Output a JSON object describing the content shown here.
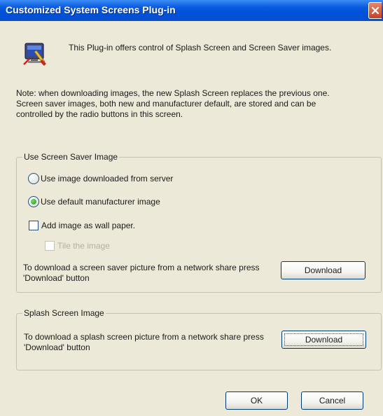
{
  "window": {
    "title": "Customized System Screens Plug-in"
  },
  "intro": "This Plug-in offers control of Splash Screen and Screen Saver images.",
  "note": {
    "line1": "Note: when downloading images, the new Splash Screen replaces the previous one.",
    "line2": "Screen saver images, both new and manufacturer default, are stored and can be controlled by the radio buttons in this screen."
  },
  "screen_saver": {
    "legend": "Use Screen Saver Image",
    "option_server": "Use image downloaded from server",
    "option_default": "Use default manufacturer image",
    "selected": "default",
    "wallpaper_label": "Add image as wall paper.",
    "tile_label": "Tile the image",
    "download_text": "To download a screen saver picture from a network share press 'Download' button",
    "download_button": "Download"
  },
  "splash": {
    "legend": "Splash Screen Image",
    "download_text": "To download a splash screen picture from a network share press 'Download' button",
    "download_button": "Download"
  },
  "footer": {
    "ok": "OK",
    "cancel": "Cancel"
  },
  "colors": {
    "titlebar": "#0a5ae0",
    "window_bg": "#ece9d8",
    "button_border": "#003c74"
  },
  "icons": {
    "app": "monitor-settings-icon",
    "close": "close-icon"
  }
}
